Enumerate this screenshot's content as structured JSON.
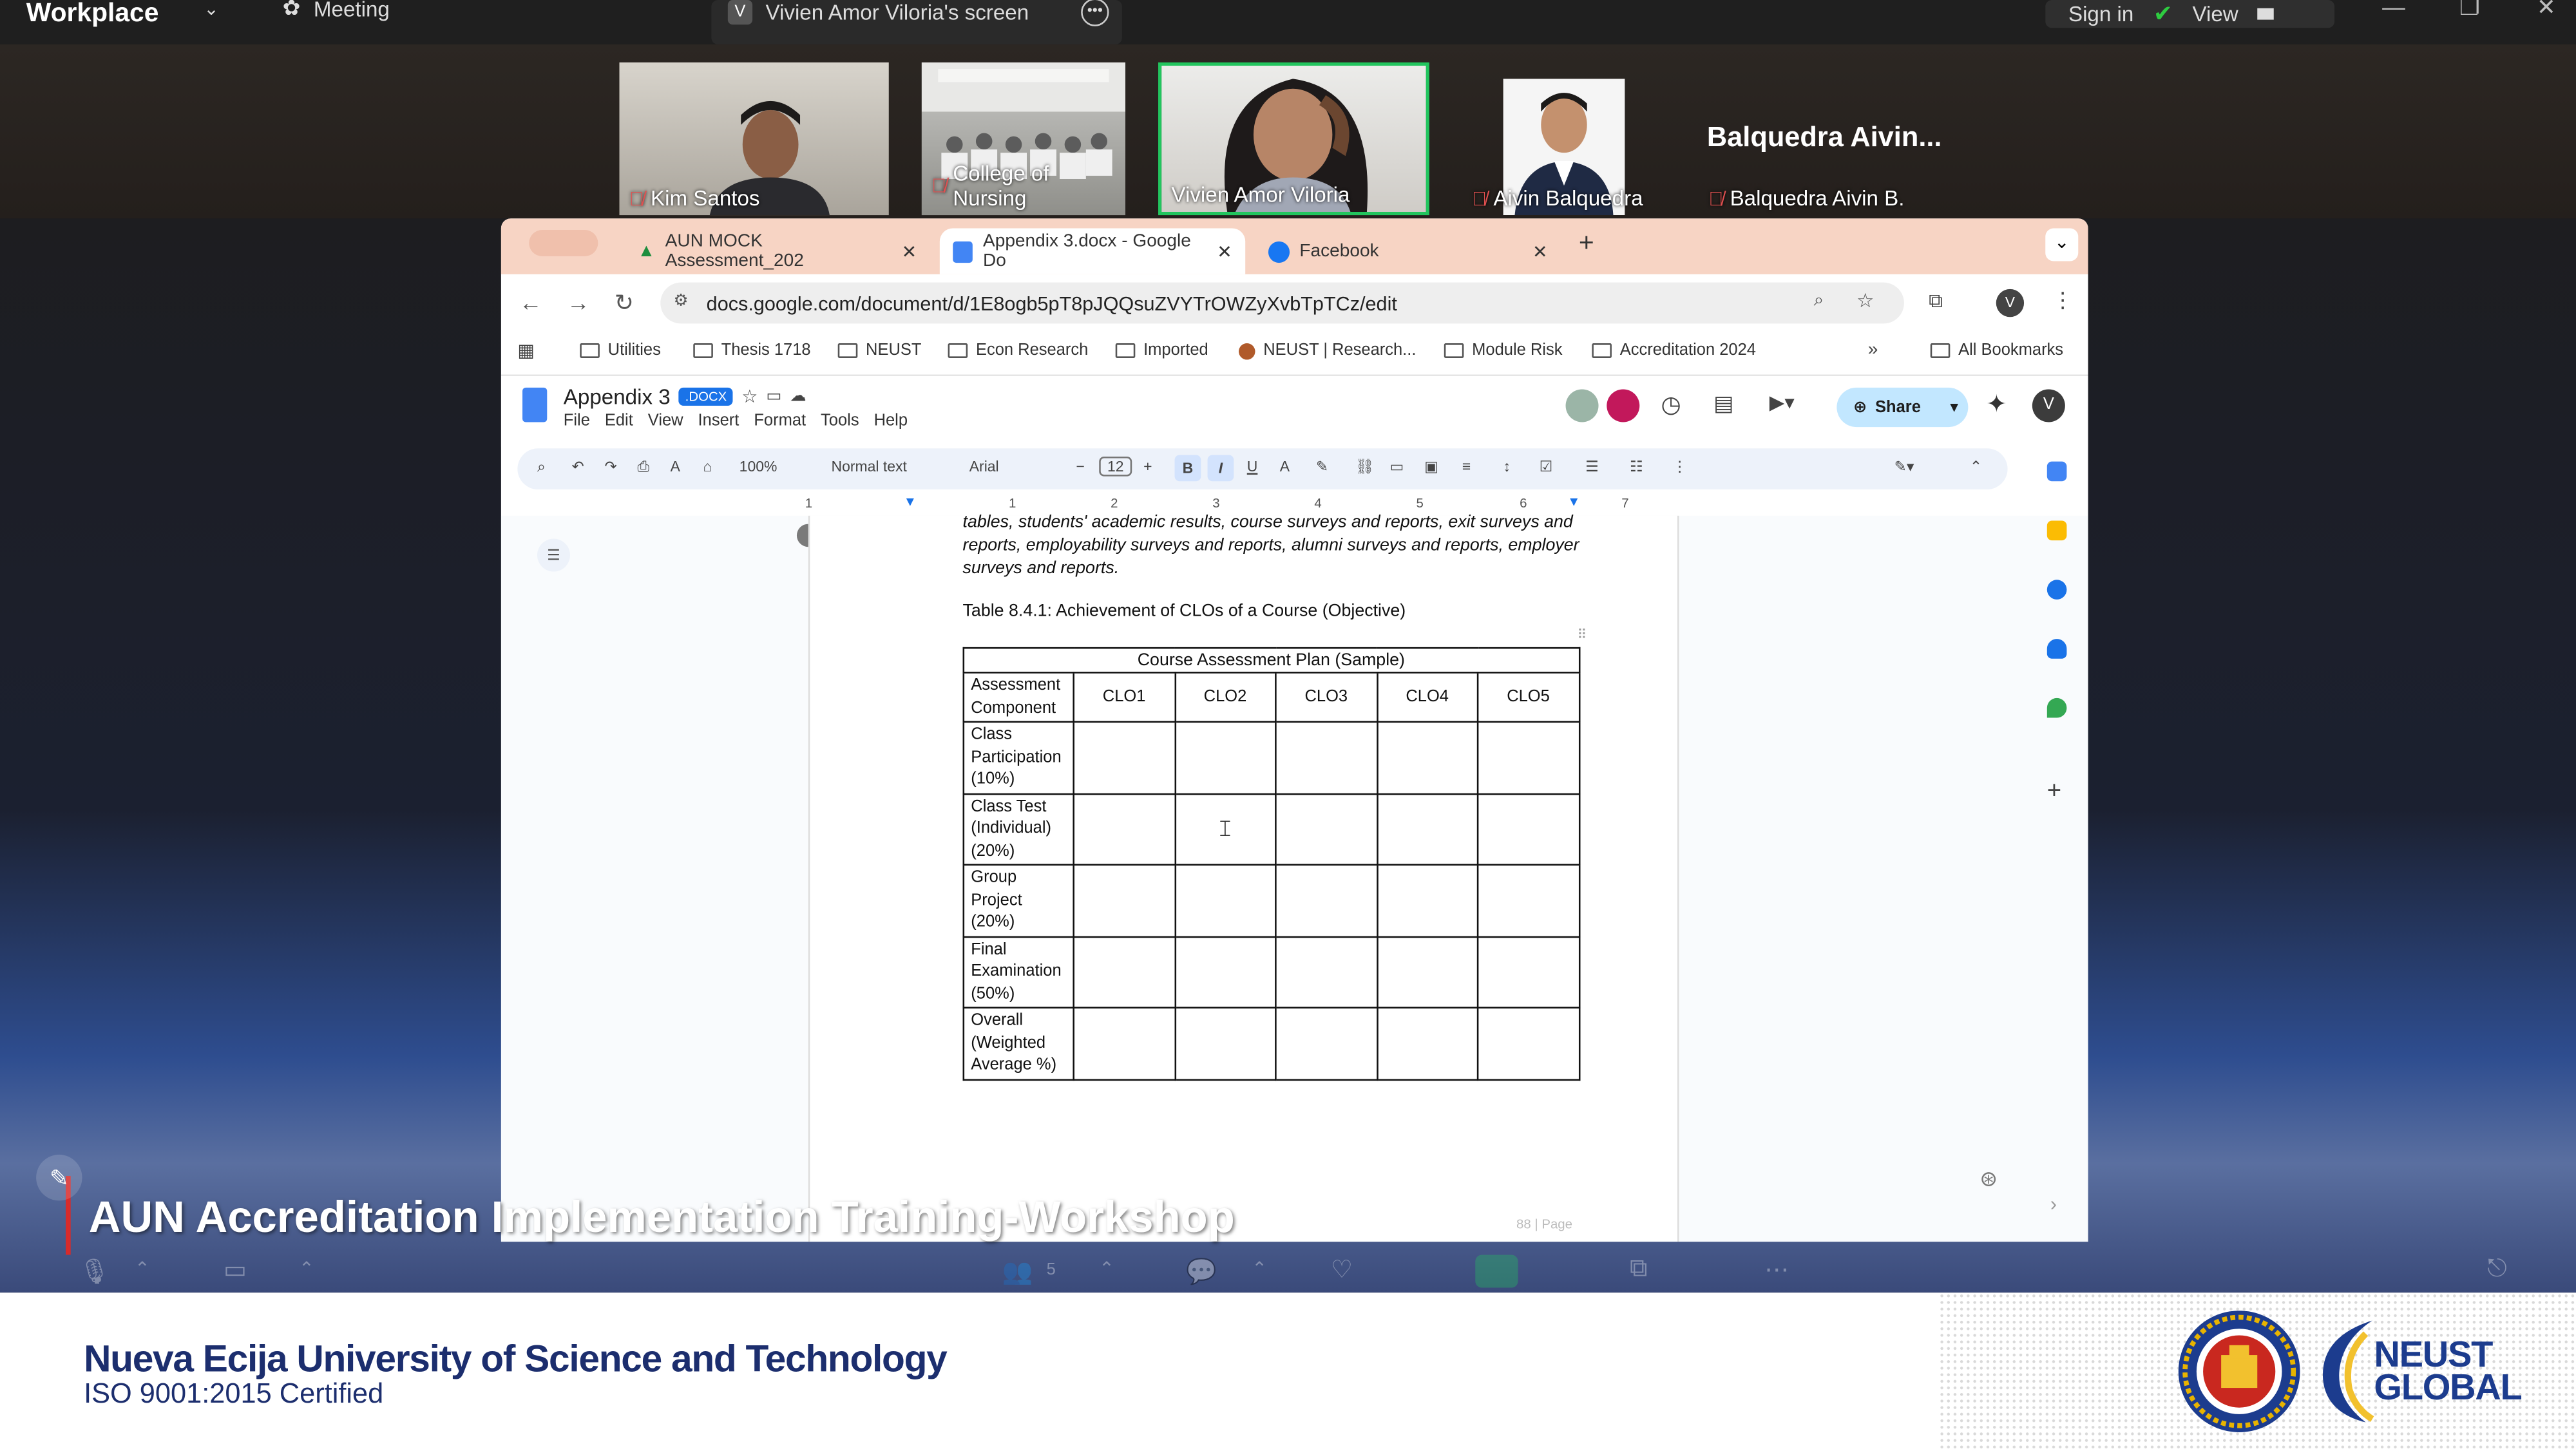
{
  "zoom": {
    "brand": "Workplace",
    "meeting_label": "Meeting",
    "share_tab_initial": "V",
    "share_tab_label": "Vivien Amor Viloria's screen",
    "sign_in": "Sign in",
    "view": "View",
    "participants_count": "5"
  },
  "participants": [
    {
      "name": "Kim Santos",
      "muted": true
    },
    {
      "name": "College of Nursing",
      "muted": true
    },
    {
      "name": "Vivien Amor Viloria",
      "muted": false,
      "active_speaker": true
    },
    {
      "name": "Aivin Balquedra",
      "muted": true
    },
    {
      "name": "Balquedra Aivin B.",
      "muted": true,
      "display_title": "Balquedra  Aivin..."
    }
  ],
  "browser": {
    "tabs": [
      {
        "label": "AUN MOCK Assessment_202",
        "icon": "google-drive-icon"
      },
      {
        "label": "Appendix 3.docx - Google Do",
        "icon": "google-docs-icon",
        "active": true
      },
      {
        "label": "Facebook",
        "icon": "facebook-icon"
      }
    ],
    "url": "docs.google.com/document/d/1E8ogb5pT8pJQQsuZVYTrOWZyXvbTpTCz/edit",
    "profile_initial": "V",
    "bookmarks": [
      "Utilities",
      "Thesis 1718",
      "NEUST",
      "Econ Research",
      "Imported",
      "NEUST | Research...",
      "Module Risk",
      "Accreditation 2024"
    ],
    "all_bookmarks": "All Bookmarks"
  },
  "docs": {
    "title": "Appendix 3",
    "badge": ".DOCX",
    "menus": [
      "File",
      "Edit",
      "View",
      "Insert",
      "Format",
      "Tools",
      "Help"
    ],
    "share": "Share",
    "avatar_initial": "V",
    "toolbar": {
      "zoom": "100%",
      "style": "Normal text",
      "font": "Arial",
      "size": "12"
    },
    "ruler_marks": [
      "1",
      "1",
      "2",
      "3",
      "4",
      "5",
      "6",
      "7"
    ],
    "body_text": "tables, students' academic results, course surveys and reports, exit surveys and reports, employability surveys and reports, alumni surveys and reports, employer surveys and reports.",
    "caption": "Table 8.4.1: Achievement of CLOs of a Course (Objective)",
    "table": {
      "title": "Course Assessment Plan (Sample)",
      "header": "Assessment Component",
      "columns": [
        "CLO1",
        "CLO2",
        "CLO3",
        "CLO4",
        "CLO5"
      ],
      "rows": [
        "Class Participation (10%)",
        "Class Test (Individual) (20%)",
        "Group Project (20%)",
        "Final Examination (50%)",
        "Overall (Weighted Average %)"
      ]
    },
    "page_number": "88 | Page"
  },
  "overlay": {
    "banner": "AUN Accreditation Implementation Training-Workshop",
    "university": "Nueva Ecija University of Science and Technology",
    "iso": "ISO 9001:2015 Certified",
    "logo_text_1": "NEUST",
    "logo_text_2": "GLOBAL"
  },
  "colors": {
    "active_speaker_border": "#22c55e",
    "share_button": "#c2e7ff",
    "tab_strip": "#f7d4c4",
    "brand_navy": "#1c2e6e",
    "banner_accent": "#d72b2b"
  }
}
